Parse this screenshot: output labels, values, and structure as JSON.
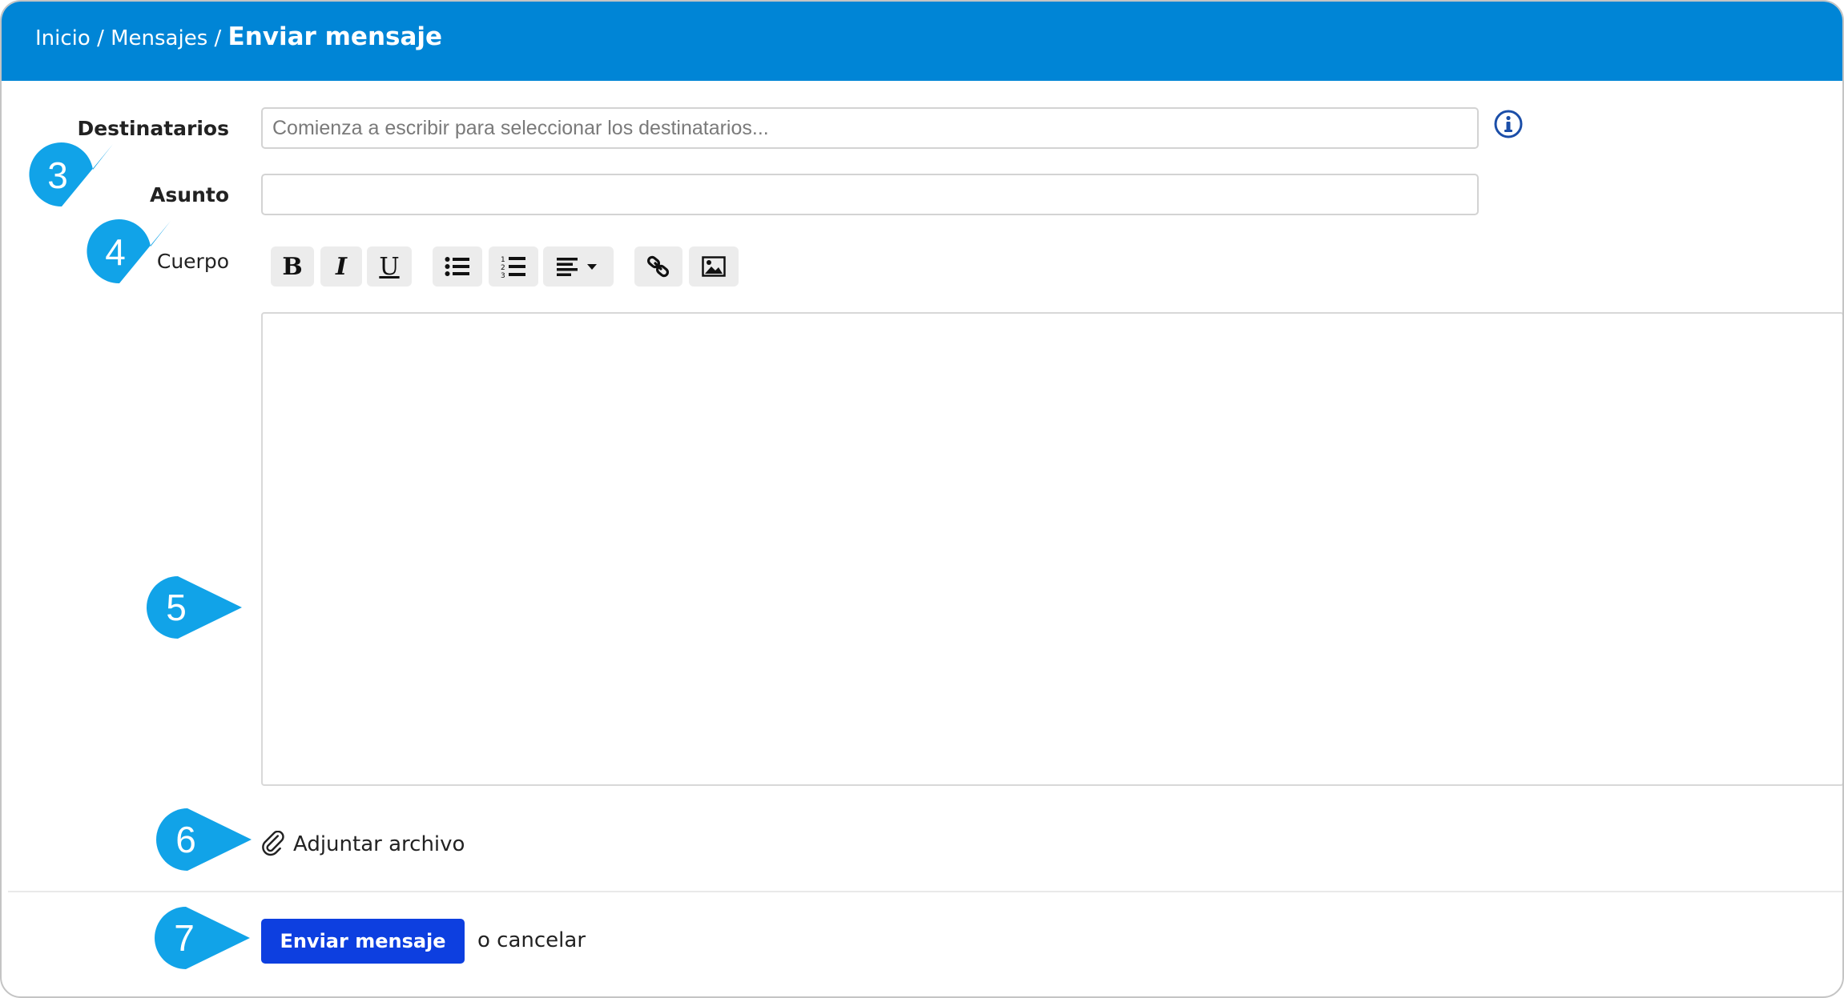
{
  "header": {
    "breadcrumb": [
      {
        "label": "Inicio"
      },
      {
        "label": "Mensajes"
      }
    ],
    "separator": "/",
    "current": "Enviar mensaje",
    "background_color": "#0085d6"
  },
  "form": {
    "recipients": {
      "label": "Destinatarios",
      "placeholder": "Comienza a escribir para seleccionar los destinatarios...",
      "value": "",
      "info_icon": "info-circle-icon"
    },
    "subject": {
      "label": "Asunto",
      "value": ""
    },
    "body": {
      "label": "Cuerpo",
      "toolbar": {
        "bold": "B",
        "italic": "I",
        "underline": "U",
        "bullet_list": "bullet-list-icon",
        "numbered_list": "numbered-list-icon",
        "align": "align-left-icon",
        "link": "link-icon",
        "image": "image-icon"
      },
      "value": ""
    },
    "attach": {
      "icon": "paperclip-icon",
      "label": "Adjuntar archivo"
    }
  },
  "actions": {
    "send_label": "Enviar mensaje",
    "send_color": "#0d3fe0",
    "cancel_label": "o cancelar"
  },
  "callouts": [
    {
      "number": "3"
    },
    {
      "number": "4"
    },
    {
      "number": "5"
    },
    {
      "number": "6"
    },
    {
      "number": "7"
    }
  ],
  "callout_color": "#11a3e8"
}
